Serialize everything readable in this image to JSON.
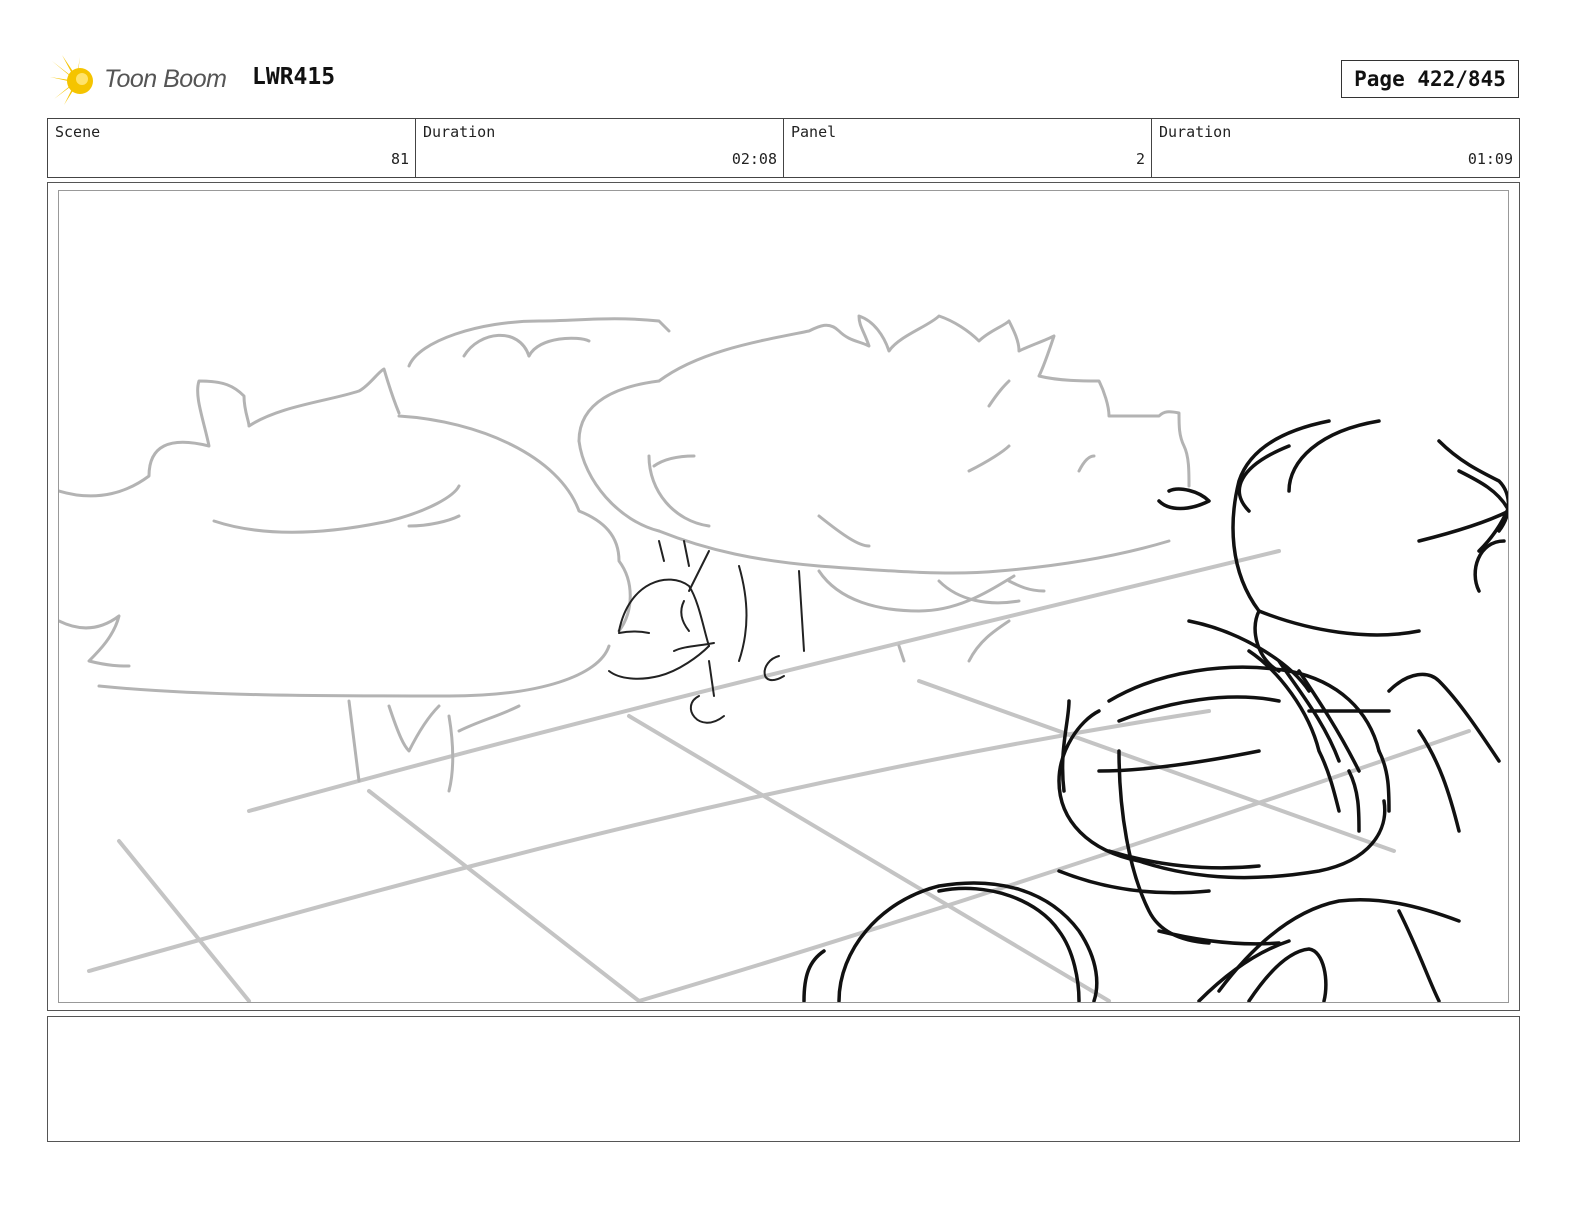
{
  "header": {
    "logo_text": "Toon Boom",
    "logo_icon": "toon-boom-burst-icon",
    "project_code": "LWR415",
    "page_label": "Page 422/845"
  },
  "info": {
    "scene_label": "Scene",
    "scene_value": "81",
    "scene_duration_label": "Duration",
    "scene_duration_value": "02:08",
    "panel_label": "Panel",
    "panel_value": "2",
    "panel_duration_label": "Duration",
    "panel_duration_value": "01:09"
  },
  "notes": {
    "text": ""
  },
  "colors": {
    "logo_accent": "#F5C400",
    "sketch_rough": "#aaaaaa",
    "sketch_ink": "#111111"
  }
}
